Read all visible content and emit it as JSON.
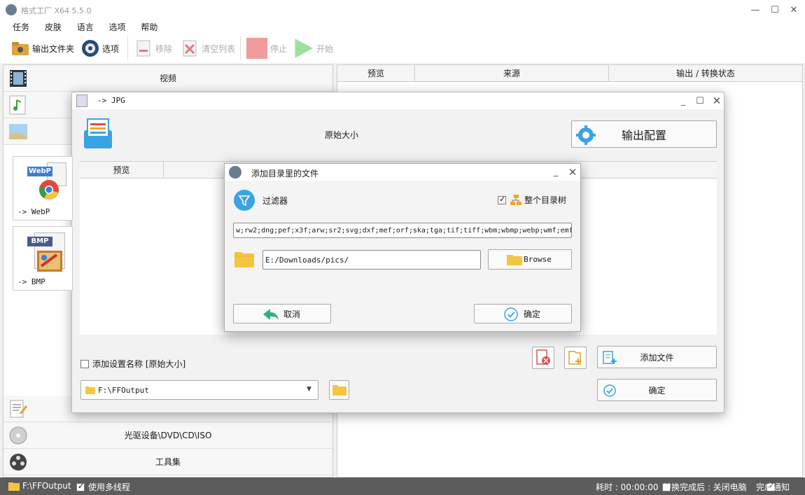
{
  "app": {
    "title": "格式工厂 X64 5.5.0"
  },
  "menu": [
    "任务",
    "皮肤",
    "语言",
    "选项",
    "帮助"
  ],
  "toolbar": {
    "output_folder": "输出文件夹",
    "options": "选项",
    "remove": "移除",
    "clear_list": "清空列表",
    "stop": "停止",
    "start": "开始"
  },
  "categories": {
    "video": "视频",
    "disc": "光驱设备\\DVD\\CD\\ISO",
    "tools": "工具集"
  },
  "task_table": {
    "columns": [
      "预览",
      "来源",
      "输出 / 转换状态"
    ]
  },
  "format_dialog": {
    "title": "-> JPG",
    "preset": "原始大小",
    "output_config": "输出配置",
    "preview_col": "预览",
    "formats": [
      {
        "badge": "WebP",
        "label": "-> WebP"
      },
      {
        "badge": "BMP",
        "label": "-> BMP"
      }
    ],
    "add_setting_name": "添加设置名称 [原始大小]",
    "output_path": "F:\\FFOutput",
    "add_file": "添加文件",
    "ok": "确定"
  },
  "add_dir_dialog": {
    "title": "添加目录里的文件",
    "filter_label": "过滤器",
    "whole_tree": "整个目录树",
    "whole_tree_checked": true,
    "extensions": "w;rw2;dng;pef;x3f;arw;sr2;svg;dxf;mef;orf;ska;tga;tif;tiff;wbm;wbmp;webp;wmf;emf",
    "path": "E:/Downloads/pics/",
    "browse": "Browse",
    "cancel": "取消",
    "ok": "确定"
  },
  "status": {
    "output": "F:\\FFOutput",
    "multithread": "使用多线程",
    "multithread_checked": true,
    "elapsed": "耗时 : 00:00:00",
    "after_done": "转换完成后 : 关闭电脑",
    "after_done_checked": false,
    "notify": "完成通知",
    "notify_checked": true
  },
  "colors": {
    "accent": "#3aa3e3",
    "folder": "#f5c542",
    "status_bg": "#5c5c5c"
  }
}
